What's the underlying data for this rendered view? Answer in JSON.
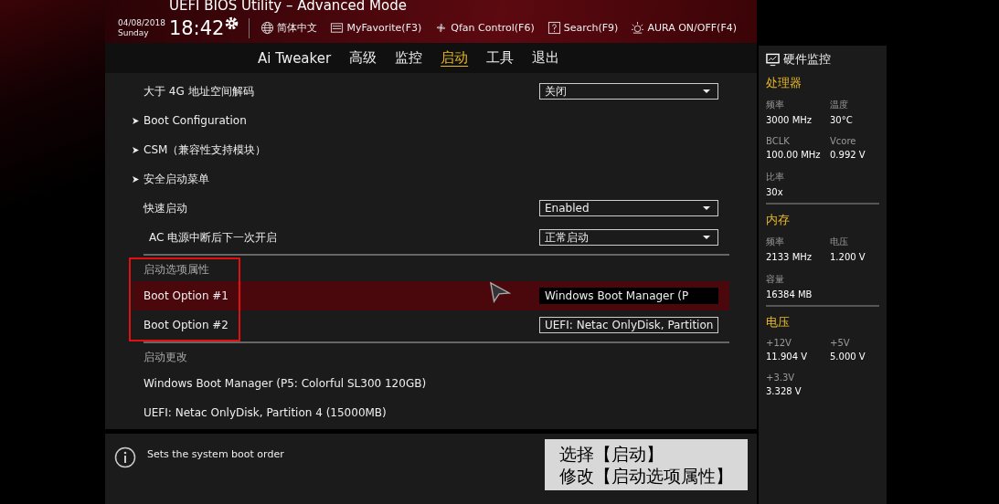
{
  "window": {
    "title": "UEFI BIOS Utility – Advanced Mode"
  },
  "clock": {
    "date": "04/08/2018",
    "day": "Sunday",
    "time": "18:42"
  },
  "toolbar": [
    {
      "label": "简体中文"
    },
    {
      "label": "MyFavorite(F3)"
    },
    {
      "label": "Qfan Control(F6)"
    },
    {
      "label": "Search(F9)"
    },
    {
      "label": "AURA ON/OFF(F4)"
    }
  ],
  "tabs": [
    {
      "label": "Ai Tweaker",
      "selected": false
    },
    {
      "label": "高级",
      "selected": false
    },
    {
      "label": "监控",
      "selected": false
    },
    {
      "label": "启动",
      "selected": true
    },
    {
      "label": "工具",
      "selected": false
    },
    {
      "label": "退出",
      "selected": false
    }
  ],
  "settings": [
    {
      "kind": "dropdown",
      "label": "大于 4G 地址空间解码",
      "value": "关闭"
    },
    {
      "kind": "submenu",
      "label": "Boot Configuration"
    },
    {
      "kind": "submenu",
      "label": "CSM（兼容性支持模块）"
    },
    {
      "kind": "submenu",
      "label": "安全启动菜单"
    },
    {
      "kind": "dropdown",
      "label": "快速启动",
      "value": "Enabled"
    },
    {
      "kind": "dropdown",
      "label": "AC 电源中断后下一次开启",
      "value": "正常启动",
      "indented": true
    }
  ],
  "boot_option_priorities": {
    "title": "启动选项属性",
    "annotated": true,
    "rows": [
      {
        "label": "Boot Option #1",
        "value": "Windows Boot Manager (P",
        "selected": true
      },
      {
        "label": "Boot Option #2",
        "value": "UEFI: Netac OnlyDisk, Partition",
        "selected": false
      }
    ]
  },
  "boot_override": {
    "title": "启动更改",
    "rows": [
      "Windows Boot Manager (P5: Colorful SL300 120GB)",
      "UEFI: Netac OnlyDisk, Partition 4 (15000MB)"
    ]
  },
  "help": {
    "text": "Sets the system boot order"
  },
  "caption": [
    "选择【启动】",
    "修改【启动选项属性】"
  ],
  "hardware_monitor": {
    "title": "硬件监控",
    "sections": [
      {
        "title": "处理器",
        "items": [
          {
            "label": "频率",
            "value": "3000 MHz"
          },
          {
            "label": "温度",
            "value": "30°C"
          },
          {
            "label": "BCLK",
            "value": "100.00 MHz"
          },
          {
            "label": "Vcore",
            "value": "0.992 V"
          },
          {
            "label": "比率",
            "value": "30x"
          }
        ]
      },
      {
        "title": "内存",
        "items": [
          {
            "label": "频率",
            "value": "2133 MHz"
          },
          {
            "label": "电压",
            "value": "1.200 V"
          },
          {
            "label": "容量",
            "value": "16384 MB"
          }
        ]
      },
      {
        "title": "电压",
        "items": [
          {
            "label": "+12V",
            "value": "11.904 V"
          },
          {
            "label": "+5V",
            "value": "5.000 V"
          },
          {
            "label": "+3.3V",
            "value": "3.328 V"
          }
        ]
      }
    ]
  }
}
